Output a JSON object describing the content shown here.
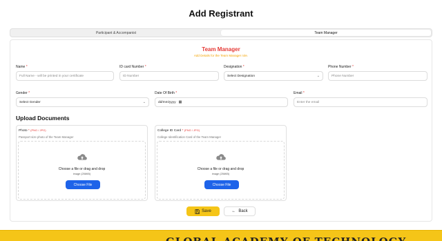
{
  "page": {
    "title": "Add Registrant"
  },
  "tabs": [
    {
      "label": "Participant & Accompanist",
      "active": false
    },
    {
      "label": "Team Manager",
      "active": true
    }
  ],
  "form": {
    "heading": "Team Manager",
    "subheading": "Add Details for the Team Manager role.",
    "name": {
      "label": "Name",
      "required": "*",
      "placeholder": "Full Name - will be printed in your certificate"
    },
    "id_card": {
      "label": "ID card Number",
      "required": "*",
      "placeholder": "ID Number"
    },
    "designation": {
      "label": "Designation",
      "required": "*",
      "value": "Select Designation"
    },
    "phone": {
      "label": "Phone Number",
      "required": "*",
      "placeholder": "Phone Number"
    },
    "gender": {
      "label": "Gender",
      "required": "*",
      "value": "Select Gender"
    },
    "dob": {
      "label": "Date Of Birth",
      "required": "*",
      "value": "dd/mm/yyyy"
    },
    "email": {
      "label": "Email",
      "required": "*",
      "placeholder": "Enter the email"
    }
  },
  "uploads": {
    "heading": "Upload Documents",
    "photo": {
      "label": "Photo",
      "required": "*",
      "hint": "(PNG / JPG)",
      "description": "Passport size photo of the Team Manager",
      "drop_text": "Choose a file or drag and drop",
      "drop_sub": "image (256KB)",
      "button": "Choose File"
    },
    "college_id": {
      "label": "College ID Card",
      "required": "*",
      "hint": "(PNG / JPG)",
      "description": "College Identification Card of the Team Manager",
      "drop_text": "Choose a file or drag and drop",
      "drop_sub": "image (256KB)",
      "button": "Choose File"
    }
  },
  "actions": {
    "save": "Save",
    "back": "Back"
  },
  "footer": {
    "text": "GLOBAL ACADEMY OF TECHNOLOGY"
  },
  "colors": {
    "accent_blue": "#1e63e9",
    "brand_yellow": "#f5c518",
    "heading_red": "#e53935",
    "sub_orange": "#f4a300"
  },
  "icons": {
    "save": "floppy-disk-icon",
    "back": "arrow-left-icon",
    "upload": "cloud-upload-icon",
    "dropdown": "chevron-down-icon",
    "date": "calendar-icon"
  }
}
